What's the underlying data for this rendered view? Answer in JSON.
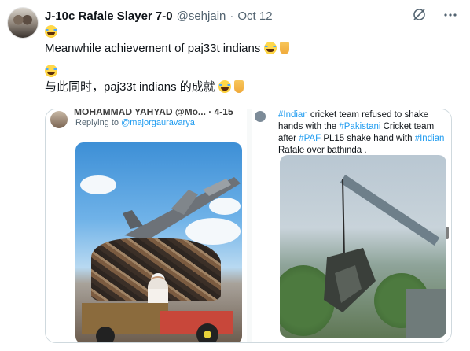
{
  "tweet": {
    "author_name": "J-10c Rafale Slayer 7-0",
    "author_handle": "@sehjain",
    "separator": "·",
    "date": "Oct 12",
    "line1": "",
    "line2": "Meanwhile achievement of paj33t indians",
    "line3": "",
    "line4": "与此同时，paj33t indians 的成就",
    "icons": {
      "grok": "grok-icon",
      "more": "more-icon",
      "laugh": "tears-of-joy-emoji",
      "point": "pointing-down-emoji"
    }
  },
  "media_left": {
    "quoted_name": "MOHAMMAD YAHYAD @Mo... · 4-15",
    "replying_prefix": "Replying to",
    "replying_mention": "@majorgauravarya"
  },
  "media_right": {
    "text_parts": [
      {
        "text": "#Indian",
        "tag": true
      },
      {
        "text": " cricket team refused to shake hands with the ",
        "tag": false
      },
      {
        "text": "#Pakistani",
        "tag": true
      },
      {
        "text": " Cricket team after ",
        "tag": false
      },
      {
        "text": "#PAF",
        "tag": true
      },
      {
        "text": " PL15 shake hand with ",
        "tag": false
      },
      {
        "text": "#Indian",
        "tag": true
      },
      {
        "text": " Rafale over bathinda .",
        "tag": false
      }
    ]
  },
  "colors": {
    "accent": "#1d9bf0",
    "text": "#0f1419",
    "secondary": "#536471",
    "border": "#cfd9de"
  }
}
